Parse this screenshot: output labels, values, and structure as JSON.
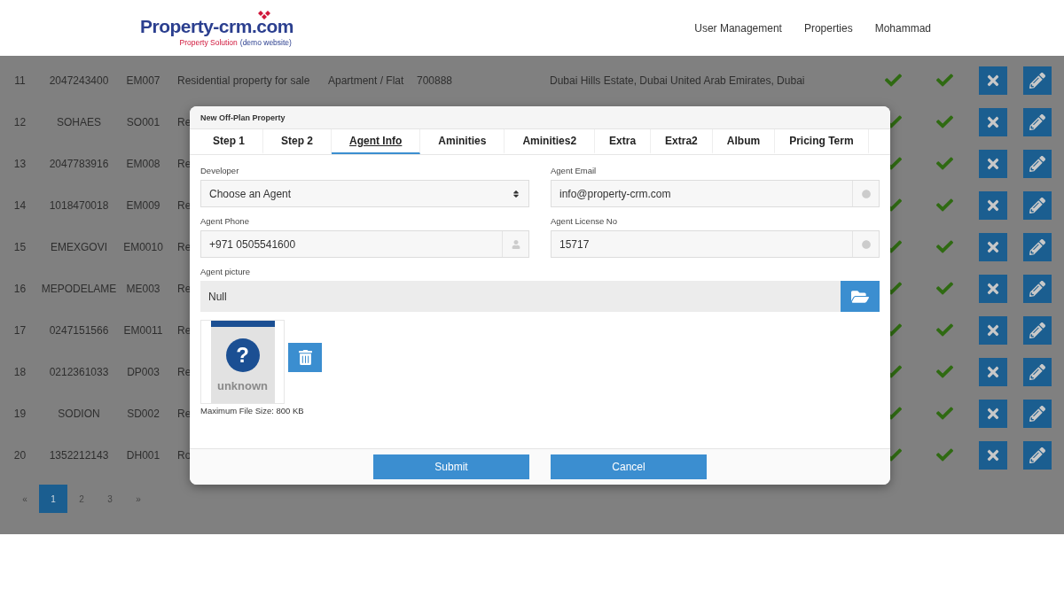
{
  "header": {
    "logo": {
      "name": "Property-crm",
      "suffix": ".com",
      "tagline": "Property Solution",
      "tagline_note": "(demo website)"
    },
    "nav": [
      "User Management",
      "Properties",
      "Mohammad"
    ]
  },
  "table": {
    "rows": [
      {
        "no": "11",
        "code": "2047243400",
        "ref": "EM007",
        "description": "Residential property for sale",
        "type": "Apartment / Flat",
        "number": "700888",
        "address": "Dubai Hills Estate, Dubai United Arab Emirates, Dubai",
        "approved": true,
        "active": true
      },
      {
        "no": "12",
        "code": "SOHAES",
        "ref": "SO001",
        "description": "Re",
        "approved": true,
        "active": true
      },
      {
        "no": "13",
        "code": "2047783916",
        "ref": "EM008",
        "description": "Re",
        "approved": true,
        "active": true
      },
      {
        "no": "14",
        "code": "1018470018",
        "ref": "EM009",
        "description": "Re",
        "approved": true,
        "active": true
      },
      {
        "no": "15",
        "code": "EMEXGOVI",
        "ref": "EM0010",
        "description": "Re",
        "approved": true,
        "active": true
      },
      {
        "no": "16",
        "code": "MEPODELAME",
        "ref": "ME003",
        "description": "Re",
        "approved": true,
        "active": true
      },
      {
        "no": "17",
        "code": "0247151566",
        "ref": "EM0011",
        "description": "Re",
        "approved": true,
        "active": true
      },
      {
        "no": "18",
        "code": "0212361033",
        "ref": "DP003",
        "description": "Re",
        "approved": true,
        "active": true
      },
      {
        "no": "19",
        "code": "SODION",
        "ref": "SD002",
        "description": "Re",
        "approved": true,
        "active": true
      },
      {
        "no": "20",
        "code": "1352212143",
        "ref": "DH001",
        "description": "Ro",
        "approved": true,
        "active": true
      }
    ]
  },
  "pagination": [
    {
      "label": "«",
      "selected": false
    },
    {
      "label": "1",
      "selected": true
    },
    {
      "label": "2",
      "selected": false
    },
    {
      "label": "3",
      "selected": false
    },
    {
      "label": "»",
      "selected": false
    }
  ],
  "modal": {
    "title": "New Off-Plan Property",
    "tabs": [
      {
        "label": "Step 1",
        "selected": false
      },
      {
        "label": "Step 2",
        "selected": false
      },
      {
        "label": "Agent Info",
        "selected": true
      },
      {
        "label": "Aminities",
        "selected": false
      },
      {
        "label": "Aminities2",
        "selected": false
      },
      {
        "label": "Extra",
        "selected": false
      },
      {
        "label": "Extra2",
        "selected": false
      },
      {
        "label": "Album",
        "selected": false
      },
      {
        "label": "Pricing Term",
        "selected": false
      }
    ],
    "fields": [
      {
        "kind": "select",
        "label": "Developer",
        "value": "Choose an Agent"
      },
      {
        "kind": "text",
        "label": "Agent Email",
        "value": "info@property-crm.com"
      },
      {
        "kind": "phone",
        "label": "Agent Phone",
        "value": "+971 0505541600"
      },
      {
        "kind": "text",
        "label": "Agent License No",
        "value": "15717"
      }
    ],
    "file": {
      "label": "Agent picture",
      "value": "Null",
      "preview_mark": "?",
      "preview_label": "unknown",
      "note": "Maximum File Size: 800 KB"
    },
    "buttons": [
      "Submit",
      "Cancel"
    ]
  }
}
